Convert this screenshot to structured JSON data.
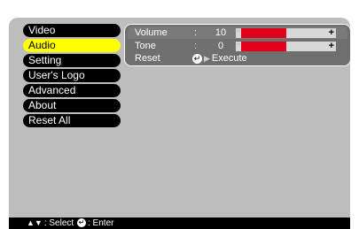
{
  "menu": {
    "items": [
      {
        "label": "Video"
      },
      {
        "label": "Audio"
      },
      {
        "label": "Setting"
      },
      {
        "label": "User's Logo"
      },
      {
        "label": "Advanced"
      },
      {
        "label": "About"
      },
      {
        "label": "Reset All"
      }
    ],
    "active_index": 1
  },
  "audio": {
    "volume": {
      "label": "Volume",
      "colon": ":",
      "value": "10",
      "level": 0.45
    },
    "tone": {
      "label": "Tone",
      "colon": ":",
      "value": "0",
      "level": 0.45
    },
    "reset": {
      "label": "Reset",
      "action": "Execute"
    },
    "bar_minus": "-",
    "bar_plus": "+"
  },
  "footer": {
    "select_label": ": Select",
    "enter_label": ": Enter"
  },
  "colors": {
    "screen_bg": "#bdbdbd",
    "active_item": "#ffff00",
    "bar_fill": "#e2001a"
  }
}
